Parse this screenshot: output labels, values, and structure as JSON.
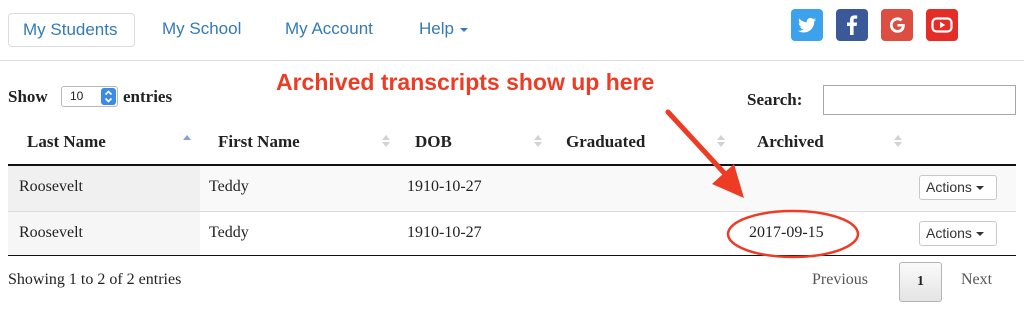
{
  "nav": {
    "tabs": [
      {
        "label": "My Students",
        "active": true
      },
      {
        "label": "My School"
      },
      {
        "label": "My Account"
      },
      {
        "label": "Help"
      }
    ],
    "social": [
      {
        "icon": "twitter-icon",
        "color": "#3ea1ec"
      },
      {
        "icon": "facebook-icon",
        "color": "#3b5998"
      },
      {
        "icon": "google-plus-icon",
        "color": "#dc4e41"
      },
      {
        "icon": "youtube-icon",
        "color": "#e52d27"
      }
    ]
  },
  "table_controls": {
    "show_label": "Show",
    "page_length": "10",
    "entries_label": "entries",
    "search_label": "Search:",
    "search_value": ""
  },
  "annotation": {
    "text": "Archived transcripts show up here",
    "color": "#ee3b24"
  },
  "table": {
    "columns": [
      "Last Name",
      "First Name",
      "DOB",
      "Graduated",
      "Archived"
    ],
    "sorted_column": "Last Name",
    "sort_direction": "ascending",
    "rows": [
      {
        "last_name": "Roosevelt",
        "first_name": "Teddy",
        "dob": "1910-10-27",
        "graduated": "",
        "archived": "",
        "action": "Actions"
      },
      {
        "last_name": "Roosevelt",
        "first_name": "Teddy",
        "dob": "1910-10-27",
        "graduated": "",
        "archived": "2017-09-15",
        "action": "Actions"
      }
    ]
  },
  "footer": {
    "info": "Showing 1 to 2 of 2 entries",
    "previous": "Previous",
    "current_page": "1",
    "next": "Next"
  }
}
